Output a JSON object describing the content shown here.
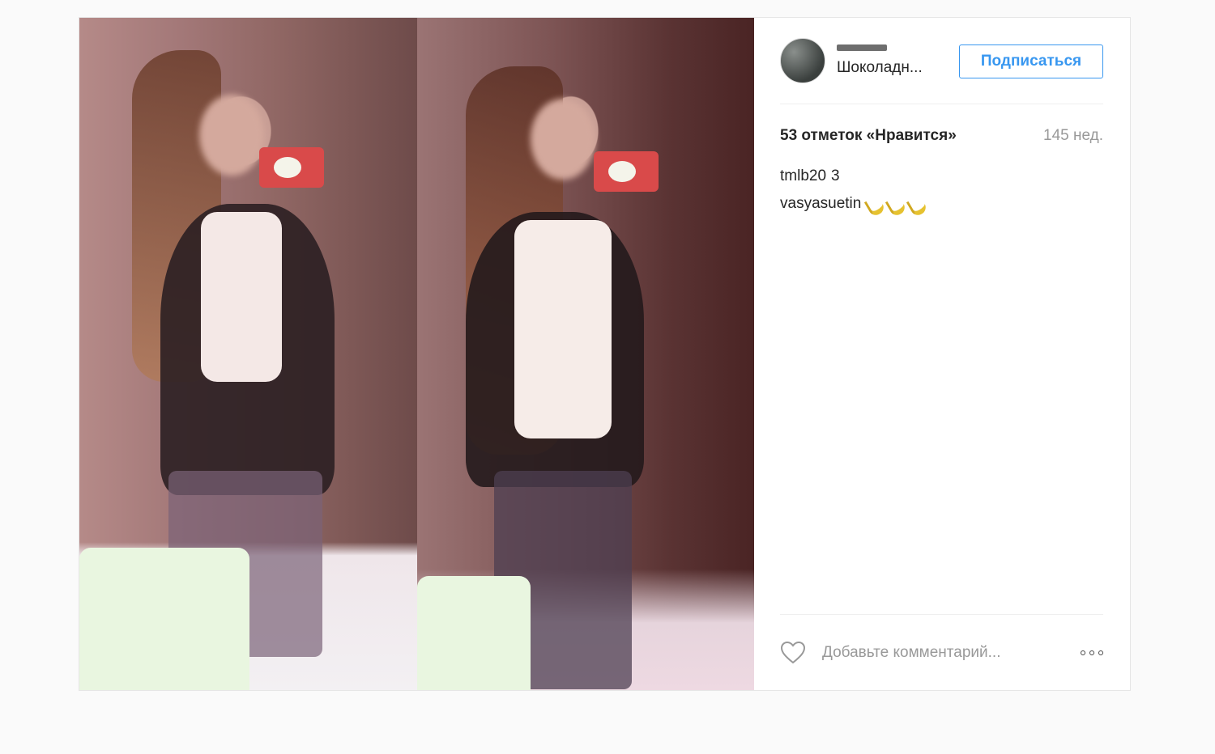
{
  "post": {
    "photo_alt": "photo",
    "header": {
      "location": "Шоколадн...",
      "follow_label": "Подписаться"
    },
    "stats": {
      "likes": "53 отметок «Нравится»",
      "time": "145 нед."
    },
    "comments": [
      {
        "user": "tmlb20",
        "text": "3"
      },
      {
        "user": "vasyasuetin",
        "text": "",
        "emoji": [
          "banana-emoji",
          "banana-emoji",
          "banana-emoji"
        ]
      }
    ],
    "footer": {
      "comment_placeholder": "Добавьте комментарий..."
    }
  },
  "icons": {
    "like": "heart-icon",
    "more": "more-options-icon"
  },
  "colors": {
    "accent": "#3897f0",
    "border": "#efefef",
    "muted": "#999999"
  }
}
